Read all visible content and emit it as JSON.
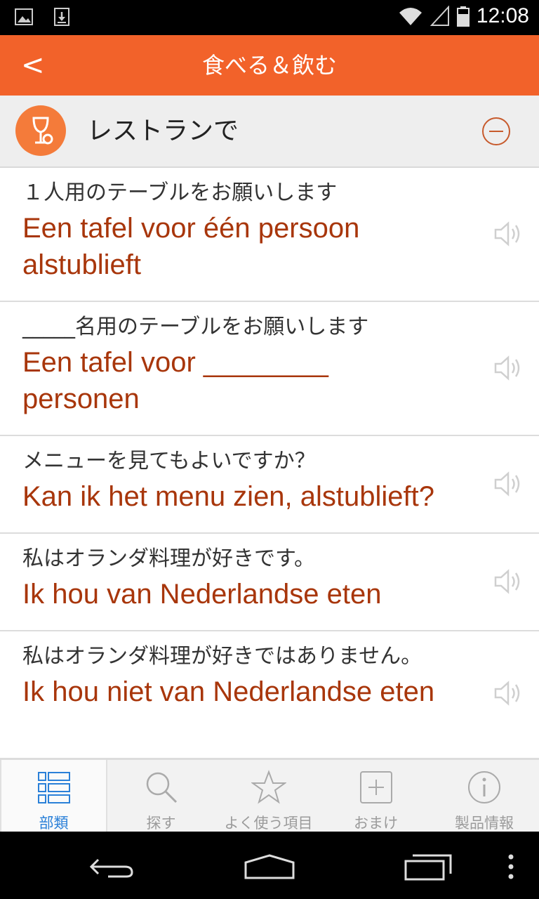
{
  "status_bar": {
    "time": "12:08"
  },
  "app_bar": {
    "title": "食べる＆飲む",
    "back_label": "<"
  },
  "category": {
    "title": "レストランで"
  },
  "phrases": [
    {
      "jp": "１人用のテーブルをお願いします",
      "nl": "Een tafel voor één persoon alstublieft"
    },
    {
      "jp": "_____名用のテーブルをお願いします",
      "nl": "Een tafel voor ________ personen"
    },
    {
      "jp": "メニューを見てもよいですか？",
      "nl": "Kan ik het menu zien, alstublieft?"
    },
    {
      "jp": "私はオランダ料理が好きです。",
      "nl": "Ik hou van Nederlandse eten"
    },
    {
      "jp": "私はオランダ料理が好きではありません。",
      "nl": "Ik hou niet van Nederlandse eten"
    }
  ],
  "tabs": [
    {
      "label": "部類",
      "icon": "list-icon",
      "active": true
    },
    {
      "label": "探す",
      "icon": "search-icon",
      "active": false
    },
    {
      "label": "よく使う項目",
      "icon": "star-icon",
      "active": false
    },
    {
      "label": "おまけ",
      "icon": "plus-box-icon",
      "active": false
    },
    {
      "label": "製品情報",
      "icon": "info-icon",
      "active": false
    }
  ],
  "colors": {
    "accent": "#f2622a",
    "phrase_text": "#a8360b",
    "active_tab": "#2a80d8"
  }
}
